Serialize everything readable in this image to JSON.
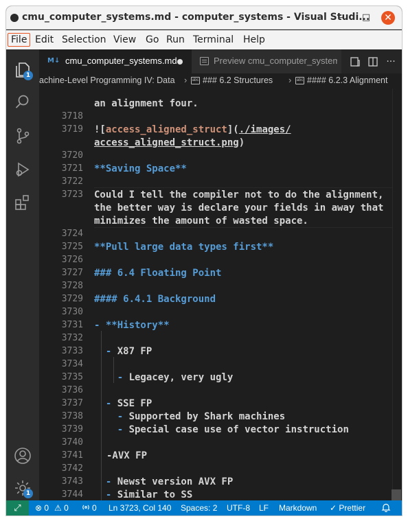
{
  "window": {
    "title": "cmu_computer_systems.md - computer_systems - Visual Studi...",
    "min_glyph": "–",
    "max_glyph": "□",
    "close_glyph": "✕"
  },
  "menu": [
    "File",
    "Edit",
    "Selection",
    "View",
    "Go",
    "Run",
    "Terminal",
    "Help"
  ],
  "activity": {
    "explorer_badge": "1",
    "settings_badge": "1"
  },
  "tabs": {
    "active_icon": "M↓",
    "active_label": "cmu_computer_systems.md",
    "preview_label": "Preview cmu_computer_systems.md",
    "more_glyph": "···"
  },
  "breadcrumb": {
    "part1": "achine-Level Programming IV: Data",
    "sep": "›",
    "icon_text": "abc",
    "part2": "### 6.2 Structures",
    "part3": "#### 6.2.3 Alignment"
  },
  "lines": [
    {
      "n": "",
      "text": "an alignment four."
    },
    {
      "n": "3718",
      "text": ""
    },
    {
      "n": "3719",
      "text": ""
    },
    {
      "n": "",
      "text": ""
    },
    {
      "n": "3720",
      "text": ""
    },
    {
      "n": "3721",
      "text": "**Saving Space**"
    },
    {
      "n": "3722",
      "text": ""
    },
    {
      "n": "3723",
      "text": "Could I tell the compiler not to do the alignment,"
    },
    {
      "n": "",
      "text": "the better way is declare your fields in away that"
    },
    {
      "n": "",
      "text": "minimizes the amount of wasted space."
    },
    {
      "n": "3724",
      "text": ""
    },
    {
      "n": "3725",
      "text": "**Pull large data types first**"
    },
    {
      "n": "3726",
      "text": ""
    },
    {
      "n": "3727",
      "text": "### 6.4 Floating Point"
    },
    {
      "n": "3728",
      "text": ""
    },
    {
      "n": "3729",
      "text": "#### 6.4.1 Background"
    },
    {
      "n": "3730",
      "text": ""
    },
    {
      "n": "3731",
      "text": ""
    },
    {
      "n": "3732",
      "text": ""
    },
    {
      "n": "3733",
      "text": ""
    },
    {
      "n": "3734",
      "text": ""
    },
    {
      "n": "3735",
      "text": ""
    },
    {
      "n": "3736",
      "text": ""
    },
    {
      "n": "3737",
      "text": ""
    },
    {
      "n": "3738",
      "text": ""
    },
    {
      "n": "3739",
      "text": ""
    },
    {
      "n": "3740",
      "text": ""
    },
    {
      "n": "3741",
      "text": "-AVX FP"
    },
    {
      "n": "3742",
      "text": ""
    },
    {
      "n": "3743",
      "text": ""
    },
    {
      "n": "3744",
      "text": ""
    }
  ],
  "rich": {
    "img_bang": "![",
    "img_alt": "access_aligned_struct",
    "img_mid": "](",
    "img_path1": "./images/",
    "img_path2": "access_aligned_struct.png",
    "img_close": ")",
    "l3731_dash": "- ",
    "l3731_text": "**History**",
    "l3733_dash": "- ",
    "l3733_text": "X87 FP",
    "l3735_dash": "- ",
    "l3735_text": "Legacey, very ugly",
    "l3737_dash": "- ",
    "l3737_text": "SSE FP",
    "l3738_dash": "- ",
    "l3738_text": "Supported by Shark machines",
    "l3739_dash": "- ",
    "l3739_text": "Special case use of vector instruction",
    "l3743_dash": "- ",
    "l3743_text": "Newst version AVX FP",
    "l3744_dash": "- ",
    "l3744_text": "Similar to SS"
  },
  "status": {
    "errors": "⊗ 0",
    "warnings": "⚠ 0",
    "ports": "0",
    "position": "Ln 3723, Col 140",
    "spaces": "Spaces: 2",
    "encoding": "UTF-8",
    "eol": "LF",
    "language": "Markdown",
    "prettier": "✓ Prettier"
  },
  "colors": {
    "status_bar": "#007acc",
    "heading_blue": "#569cd6",
    "link_orange": "#ce9178",
    "close_button": "#e95420"
  }
}
